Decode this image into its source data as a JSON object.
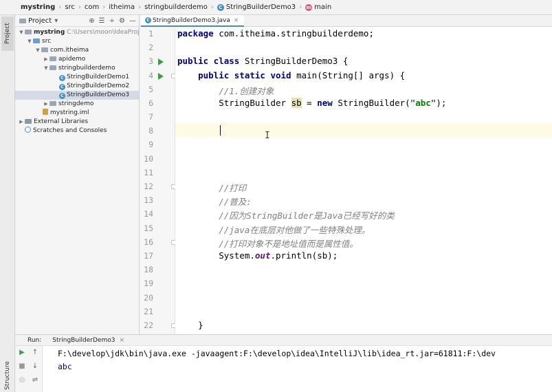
{
  "breadcrumb": {
    "project": "mystring",
    "items": [
      "src",
      "com",
      "itheima",
      "stringbuilderdemo",
      "StringBuilderDemo3",
      "main"
    ]
  },
  "side_tabs": {
    "project": "Project",
    "structure": "Structure"
  },
  "project_panel": {
    "title": "Project",
    "tree": [
      {
        "label": "mystring",
        "hint": "C:\\Users\\moon\\IdeaProjec",
        "expanded": true
      },
      {
        "label": "src",
        "expanded": true
      },
      {
        "label": "com.itheima",
        "expanded": true
      },
      {
        "label": "apidemo",
        "expanded": false
      },
      {
        "label": "stringbuilderdemo",
        "expanded": true
      },
      {
        "label": "StringBuilderDemo1"
      },
      {
        "label": "StringBuilderDemo2"
      },
      {
        "label": "StringBuilderDemo3",
        "selected": true
      },
      {
        "label": "stringdemo",
        "expanded": false
      },
      {
        "label": "mystring.iml"
      },
      {
        "label": "External Libraries",
        "expanded": false
      },
      {
        "label": "Scratches and Consoles"
      }
    ]
  },
  "editor": {
    "tab_label": "StringBuilderDemo3.java",
    "line_numbers": [
      "1",
      "2",
      "3",
      "4",
      "5",
      "6",
      "7",
      "8",
      "9",
      "10",
      "11",
      "12",
      "13",
      "14",
      "15",
      "16",
      "17",
      "18",
      "19",
      "20",
      "21",
      "22"
    ],
    "code": {
      "l1_kw": "package",
      "l1_rest": " com.itheima.stringbuilderdemo;",
      "l3_kw": "public class",
      "l3_rest": " StringBuilderDemo3 {",
      "l4_kw": "    public static void",
      "l4_rest": " main(String[] args) {",
      "l5": "        //1.创建对象",
      "l6_a": "        StringBuilder ",
      "l6_var": "sb",
      "l6_b": " = ",
      "l6_kw": "new",
      "l6_c": " StringBuilder(",
      "l6_str": "\"abc\"",
      "l6_d": ");",
      "l12": "        //打印",
      "l13": "        //普及:",
      "l14": "        //因为StringBuilder是Java已经写好的类",
      "l15": "        //java在底层对他做了一些特殊处理。",
      "l16": "        //打印对象不是地址值而是属性值。",
      "l17_a": "        System.",
      "l17_fld": "out",
      "l17_b": ".println(sb);",
      "l22": "    }"
    }
  },
  "run_panel": {
    "label": "Run:",
    "config": "StringBuilderDemo3",
    "console_cmd": "F:\\develop\\jdk\\bin\\java.exe -javaagent:F:\\develop\\idea\\IntelliJ\\lib\\idea_rt.jar=61811:F:\\dev",
    "console_out": "abc"
  }
}
